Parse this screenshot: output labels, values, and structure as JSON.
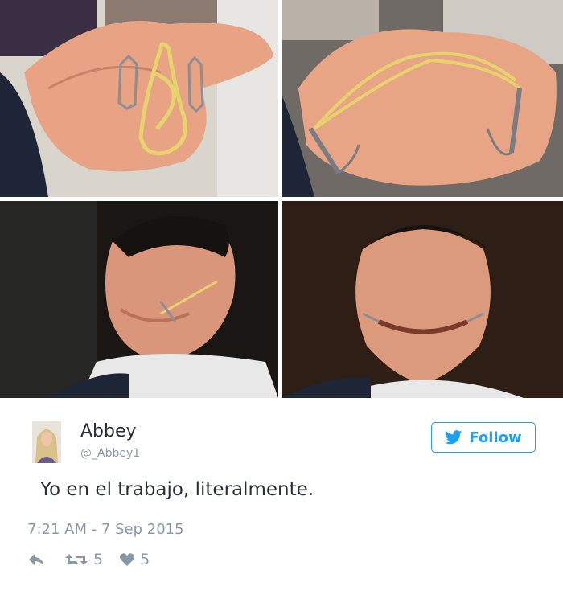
{
  "tweet": {
    "author_name": "Abbey",
    "author_handle": "@_Abbey1",
    "follow_label": "Follow",
    "text": "Yo en el trabajo, literalmente.",
    "timestamp": "7:21 AM - 7 Sep 2015",
    "retweet_count": "5",
    "like_count": "5"
  },
  "colors": {
    "accent": "#1da1f2",
    "text": "#292f33",
    "muted": "#8899a6"
  },
  "icons": [
    "reply-icon",
    "retweet-icon",
    "heart-icon",
    "bird-icon"
  ]
}
